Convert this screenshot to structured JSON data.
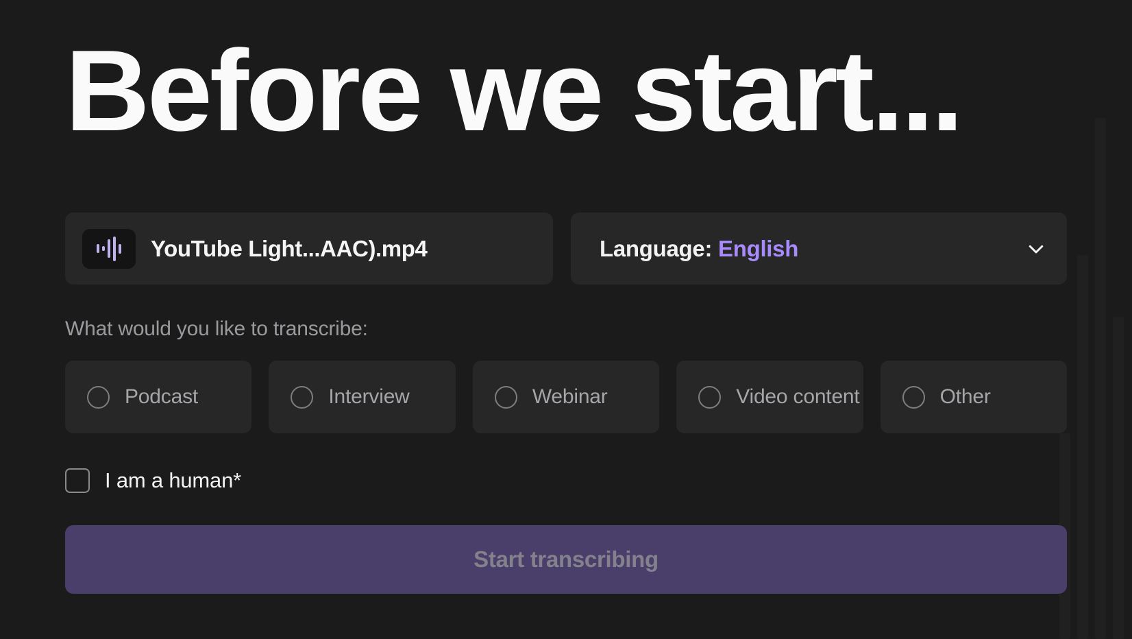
{
  "headline": "Before we start...",
  "file": {
    "icon": "audio-waveform-icon",
    "name": "YouTube Light...AAC).mp4"
  },
  "language": {
    "label": "Language:",
    "value": "English",
    "chevron_icon": "chevron-down-icon"
  },
  "question": "What would you like to transcribe:",
  "options": [
    {
      "label": "Podcast",
      "selected": false
    },
    {
      "label": "Interview",
      "selected": false
    },
    {
      "label": "Webinar",
      "selected": false
    },
    {
      "label": "Video content",
      "selected": false
    },
    {
      "label": "Other",
      "selected": false
    }
  ],
  "human_check": {
    "label": "I am a human*",
    "checked": false
  },
  "submit": {
    "label": "Start transcribing",
    "disabled": true
  },
  "colors": {
    "page_background": "#1b1b1b",
    "card_background": "#272727",
    "accent_purple": "#a78bfa",
    "button_background": "#4a3f6b",
    "button_text": "#83818c",
    "text_primary": "#f5f5f5",
    "text_muted": "#9a9a9e"
  }
}
